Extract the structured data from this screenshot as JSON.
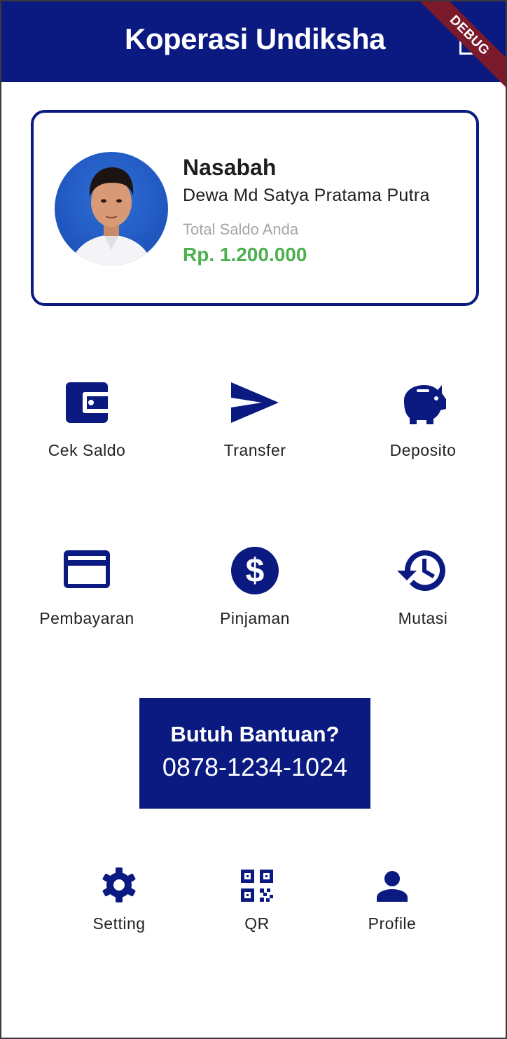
{
  "appbar": {
    "title": "Koperasi Undiksha",
    "debug_banner": "DEBUG"
  },
  "profile": {
    "role": "Nasabah",
    "name": "Dewa Md Satya Pratama Putra",
    "balance_label": "Total Saldo Anda",
    "balance_value": "Rp. 1.200.000"
  },
  "menu": [
    {
      "label": "Cek Saldo",
      "icon": "wallet-icon"
    },
    {
      "label": "Transfer",
      "icon": "send-icon"
    },
    {
      "label": "Deposito",
      "icon": "piggy-bank-icon"
    },
    {
      "label": "Pembayaran",
      "icon": "credit-card-icon"
    },
    {
      "label": "Pinjaman",
      "icon": "dollar-circle-icon"
    },
    {
      "label": "Mutasi",
      "icon": "history-icon"
    }
  ],
  "help": {
    "title": "Butuh Bantuan?",
    "phone": "0878-1234-1024"
  },
  "bottom_nav": [
    {
      "label": "Setting",
      "icon": "gear-icon"
    },
    {
      "label": "QR",
      "icon": "qr-code-icon"
    },
    {
      "label": "Profile",
      "icon": "person-icon"
    }
  ],
  "colors": {
    "primary": "#0a1a80",
    "balance_green": "#4caf50",
    "muted_text": "#a6a6a6",
    "debug_ribbon": "#7a1a2a"
  }
}
